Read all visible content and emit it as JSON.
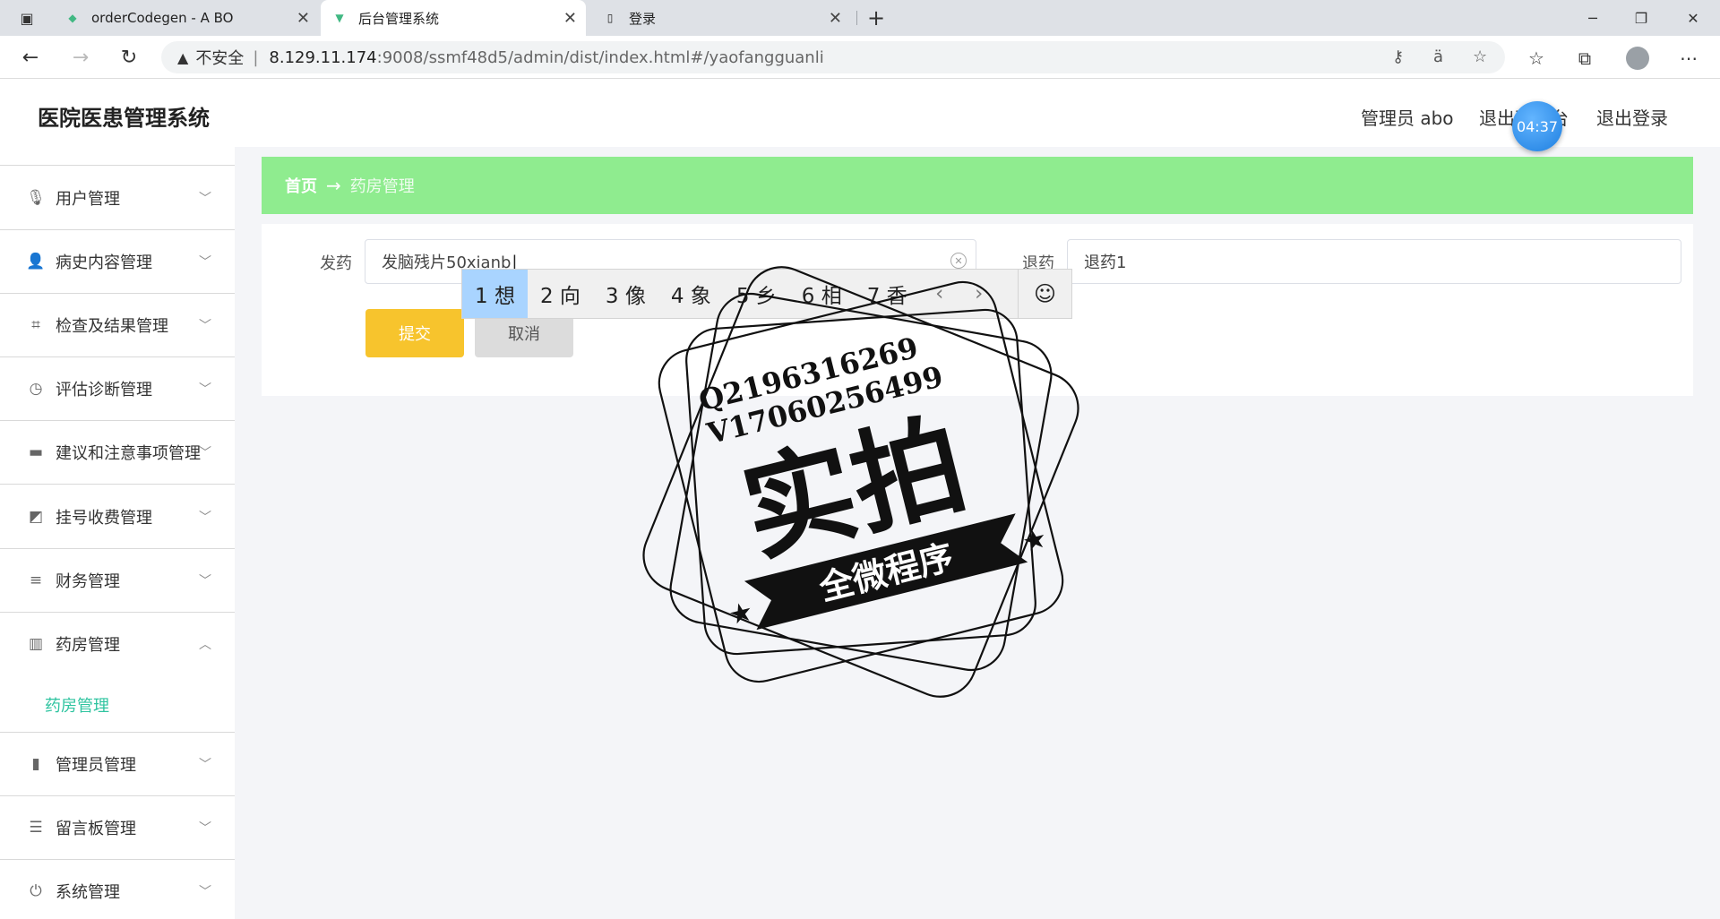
{
  "browser": {
    "tabs": [
      {
        "title": "orderCodegen - A BO",
        "icon": "vue-icon"
      },
      {
        "title": "后台管理系统",
        "icon": "vue-icon"
      },
      {
        "title": "登录",
        "icon": "page-icon"
      }
    ],
    "security_label": "不安全",
    "url_host": "8.129.11.174",
    "url_path": ":9008/ssmf48d5/admin/dist/index.html#/yaofangguanli"
  },
  "header": {
    "title": "医院医患管理系统",
    "user_label": "管理员 abo",
    "exit_label": "退出到前台",
    "logout_label": "退出登录",
    "timer": "04:37"
  },
  "sidebar": {
    "items": [
      {
        "label": "用户管理",
        "icon": "mic-icon"
      },
      {
        "label": "病史内容管理",
        "icon": "user-icon"
      },
      {
        "label": "检查及结果管理",
        "icon": "crop-icon"
      },
      {
        "label": "评估诊断管理",
        "icon": "clock-icon"
      },
      {
        "label": "建议和注意事项管理",
        "icon": "briefcase-icon"
      },
      {
        "label": "挂号收费管理",
        "icon": "chart-icon"
      },
      {
        "label": "财务管理",
        "icon": "menu-icon"
      },
      {
        "label": "药房管理",
        "icon": "building-icon"
      },
      {
        "label": "管理员管理",
        "icon": "bar-chart-icon"
      },
      {
        "label": "留言板管理",
        "icon": "sliders-icon"
      },
      {
        "label": "系统管理",
        "icon": "power-icon"
      }
    ],
    "sub_item": "药房管理"
  },
  "breadcrumb": {
    "home": "首页",
    "arrow": "→",
    "current": "药房管理"
  },
  "form": {
    "dispense_label": "发药",
    "dispense_value": "发脑残片50xianb",
    "return_label": "退药",
    "return_value": "退药1",
    "submit": "提交",
    "cancel": "取消"
  },
  "ime": {
    "candidates": [
      "1 想",
      "2 向",
      "3 像",
      "4 象",
      "5 乡",
      "6 相",
      "7 香"
    ],
    "prev": "‹",
    "next": "›",
    "emoji": "☺"
  },
  "watermark": {
    "line1": "Q2196316269",
    "line2": "V17060256499",
    "big": "实拍",
    "banner": "全微程序"
  }
}
